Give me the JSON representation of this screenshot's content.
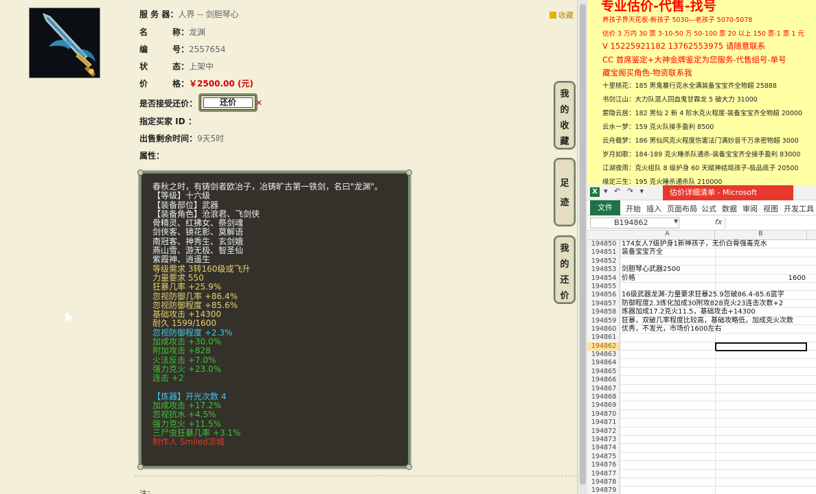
{
  "listing": {
    "server_label": "服 务 器：",
    "server_value": "人界 -- 剑胆琴心",
    "name_label": "名　　　称：",
    "name_value": "龙渊",
    "id_label": "编　　　号：",
    "id_value": "2557654",
    "status_label": "状　　　态：",
    "status_value": "上架中",
    "price_label": "价　　　格：",
    "price_value": "￥2500.00 (元)",
    "accept_offer_label": "是否接受还价：",
    "offer_button": "还价",
    "buyer_label": "指定买家 ID ：",
    "time_left_label": "出售剩余时间：",
    "time_left_value": "9天5时",
    "attr_label": "属性：",
    "favorite_link": "收藏",
    "note_label": "注："
  },
  "item_desc": [
    {
      "text": "春秋之时，有铸剑者欧冶子，冶铸旷古第一铁剑，名曰\"龙渊\"。",
      "color": "w"
    },
    {
      "text": "【等级】十六级",
      "color": "w"
    },
    {
      "text": "【装备部位】武器",
      "color": "w"
    },
    {
      "text": "【装备角色】沧浪君、飞剑侠",
      "color": "w"
    },
    {
      "text": "骨精灵、红拂女、祭剑魂",
      "color": "w"
    },
    {
      "text": "剑侠客、镜花影、莫解语",
      "color": "w"
    },
    {
      "text": "南冠客、神秀生、玄剑娥",
      "color": "w"
    },
    {
      "text": "燕山雪、游无极、智圣仙",
      "color": "w"
    },
    {
      "text": "紫霞神、逍遥生",
      "color": "w"
    },
    {
      "text": "等级需求 3转160级或飞升",
      "color": "y"
    },
    {
      "text": "力量要求 550",
      "color": "y"
    },
    {
      "text": "狂暴几率 +25.9%",
      "color": "y"
    },
    {
      "text": "忽视防御几率 +86.4%",
      "color": "y"
    },
    {
      "text": "忽视防御程度 +85.6%",
      "color": "y"
    },
    {
      "text": "基础攻击 +14300",
      "color": "y"
    },
    {
      "text": "耐久 1599/1600",
      "color": "y"
    },
    {
      "text": "忽视防御程度 +2.3%",
      "color": "c1"
    },
    {
      "text": "加成攻击 +30.0%",
      "color": "g"
    },
    {
      "text": "附加攻击 +828",
      "color": "g"
    },
    {
      "text": "火法反击 +7.0%",
      "color": "g"
    },
    {
      "text": "强力克火 +23.0%",
      "color": "g"
    },
    {
      "text": "连击 +2",
      "color": "g"
    },
    {
      "text": " ",
      "color": "w"
    },
    {
      "text": "【炼器】开光次数 4",
      "color": "c1"
    },
    {
      "text": "加成攻击 +17.2%",
      "color": "g"
    },
    {
      "text": "忽视抗水 +4.5%",
      "color": "g"
    },
    {
      "text": "强力克火 +11.5%",
      "color": "g"
    },
    {
      "text": "三尸虫狂暴几率 +3.1%",
      "color": "g"
    },
    {
      "text": "制作人 Smiled凉城",
      "color": "r"
    }
  ],
  "side_tabs": [
    {
      "label": "我的收藏"
    },
    {
      "label": "足迹"
    },
    {
      "label": "我的还价"
    }
  ],
  "doc": {
    "title": "专业估价-代售-找号",
    "lines": [
      {
        "text": "养孩子界天花板-新孩子 5030—老孩子 5070-5078",
        "cls": "red"
      },
      {
        "text": "估价 3 万内 30 票 3-10-50 万 50-100 票 20 以上 150 票-1 票 1 元",
        "cls": "red"
      },
      {
        "text": "V 15225921182    13762553975   请随意联系",
        "cls": "red big"
      },
      {
        "text": "CC 首席鉴定+大神金牌鉴定为您服务-代售组号-单号",
        "cls": "red big"
      },
      {
        "text": "藏宝阁买角色-物资联系我",
        "cls": "red big"
      },
      {
        "text": "十里桃花：185 男鬼暴行克水全满装备宝宝齐全物超 25888",
        "cls": "blk"
      },
      {
        "text": "书剑江山：大力队混人回血鬼甘霖龙 5 破大力 31000",
        "cls": "blk"
      },
      {
        "text": "雾隐云居：182 男仙 2 新 4 阶水克火程度-装备宝宝齐全物超 20000",
        "cls": "blk"
      },
      {
        "text": "云水一梦：159 克火队接手盈利 8500",
        "cls": "blk"
      },
      {
        "text": "云舟载梦：186 男仙风克火程度伤害法门满妙音千万亲密物超 3000",
        "cls": "blk"
      },
      {
        "text": "岁月如歌：184-189 克火睡杀队通杀-装备宝宝齐全接手盈利 83000",
        "cls": "blk"
      },
      {
        "text": "江湖夜雨：克火组队 8 级护身 60 天赋神结局孩子-极品底子 20500",
        "cls": "blk"
      },
      {
        "text": "缘定三生：195 克火睡杀通杀队 210000",
        "cls": "blk"
      }
    ]
  },
  "excel": {
    "quick_access": "▾ ↶ ↷ ▾",
    "doc_title": "估价详细清单 - Microsoft Excel(产...",
    "file_tab": "文件",
    "ribbon_tabs": [
      "开始",
      "插入",
      "页面布局",
      "公式",
      "数据",
      "审阅",
      "视图",
      "开发工具"
    ],
    "name_box": "B194862",
    "fx": "fx",
    "col_a": "A",
    "col_b": "B",
    "rows": [
      {
        "n": "194850",
        "a": "174女人7级护身1新神孩子，无价白骨强毒克水",
        "b": ""
      },
      {
        "n": "194851",
        "a": "装备宝宝齐全",
        "b": ""
      },
      {
        "n": "194852",
        "a": "",
        "b": ""
      },
      {
        "n": "194853",
        "a": "剑胆琴心武器2500",
        "b": ""
      },
      {
        "n": "194854",
        "a": "价格",
        "b": "1600"
      },
      {
        "n": "194855",
        "a": "",
        "b": ""
      },
      {
        "n": "194856",
        "a": "16级武器龙渊-力量要求狂暴25.9忽破86.4-85.6篮字",
        "b": ""
      },
      {
        "n": "194857",
        "a": "防御程度2.3炼化加成30附攻828克火23连击次数+2",
        "b": ""
      },
      {
        "n": "194858",
        "a": "炼器加成17.2克火11.5，基础攻击+14300",
        "b": ""
      },
      {
        "n": "194859",
        "a": "狂暴，双破几率程度比较高，基础攻略低，加成克火次数",
        "b": ""
      },
      {
        "n": "194860",
        "a": "优秀，不发光，市场价1600左右",
        "b": ""
      },
      {
        "n": "194861",
        "a": "",
        "b": ""
      },
      {
        "n": "194862",
        "a": "",
        "b": "",
        "sel": true
      },
      {
        "n": "194863",
        "a": "",
        "b": ""
      },
      {
        "n": "194864",
        "a": "",
        "b": ""
      },
      {
        "n": "194865",
        "a": "",
        "b": ""
      },
      {
        "n": "194866",
        "a": "",
        "b": ""
      },
      {
        "n": "194867",
        "a": "",
        "b": ""
      },
      {
        "n": "194868",
        "a": "",
        "b": ""
      },
      {
        "n": "194869",
        "a": "",
        "b": ""
      },
      {
        "n": "194870",
        "a": "",
        "b": ""
      },
      {
        "n": "194871",
        "a": "",
        "b": ""
      },
      {
        "n": "194872",
        "a": "",
        "b": ""
      },
      {
        "n": "194873",
        "a": "",
        "b": ""
      },
      {
        "n": "194874",
        "a": "",
        "b": ""
      },
      {
        "n": "194875",
        "a": "",
        "b": ""
      },
      {
        "n": "194876",
        "a": "",
        "b": ""
      },
      {
        "n": "194877",
        "a": "",
        "b": ""
      },
      {
        "n": "194878",
        "a": "",
        "b": ""
      },
      {
        "n": "194879",
        "a": "",
        "b": ""
      }
    ]
  }
}
